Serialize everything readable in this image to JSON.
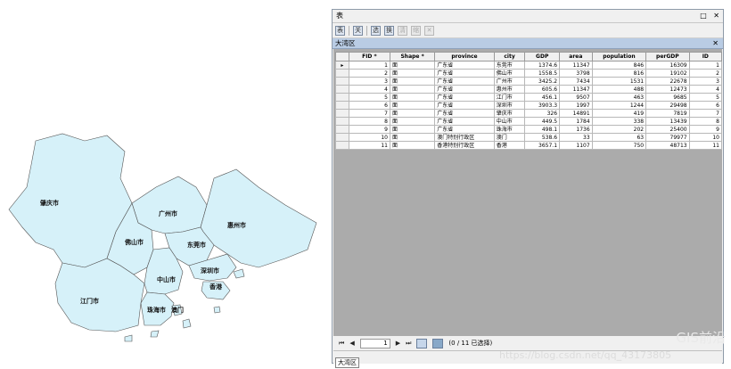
{
  "map": {
    "labels": {
      "zhaoqing": "肇庆市",
      "guangzhou": "广州市",
      "huizhou": "惠州市",
      "foshan": "佛山市",
      "dongguan": "东莞市",
      "zhongshan": "中山市",
      "shenzhen": "深圳市",
      "hongkong": "香港",
      "jiangmen": "江门市",
      "zhuhai": "珠海市",
      "macau": "澳门"
    },
    "fill_color": "#d6f1f9",
    "stroke_color": "#555555"
  },
  "window": {
    "title": "表",
    "pin": "□",
    "close": "✕",
    "toolbar": {
      "table_options": "表",
      "relate": "关",
      "select_by_attributes": "选",
      "switch_selection": "换",
      "clear_selection": "清",
      "zoom_selected": "缩",
      "delete_selected": "✕"
    },
    "tab": {
      "label": "大湾区",
      "close": "✕"
    },
    "table": {
      "columns": [
        "FID *",
        "Shape *",
        "province",
        "city",
        "GDP",
        "area",
        "population",
        "perGDP",
        "ID"
      ],
      "rows": [
        [
          "1",
          "面",
          "广东省",
          "东莞市",
          "1374.6",
          "11347",
          "846",
          "16309",
          "1"
        ],
        [
          "2",
          "面",
          "广东省",
          "佛山市",
          "1558.5",
          "3798",
          "816",
          "19102",
          "2"
        ],
        [
          "3",
          "面",
          "广东省",
          "广州市",
          "3425.2",
          "7434",
          "1531",
          "22678",
          "3"
        ],
        [
          "4",
          "面",
          "广东省",
          "惠州市",
          "605.6",
          "11347",
          "488",
          "12473",
          "4"
        ],
        [
          "5",
          "面",
          "广东省",
          "江门市",
          "456.1",
          "9507",
          "463",
          "9685",
          "5"
        ],
        [
          "6",
          "面",
          "广东省",
          "深圳市",
          "3903.3",
          "1997",
          "1244",
          "29498",
          "6"
        ],
        [
          "7",
          "面",
          "广东省",
          "肇庆市",
          "326",
          "14891",
          "419",
          "7819",
          "7"
        ],
        [
          "8",
          "面",
          "广东省",
          "中山市",
          "449.5",
          "1784",
          "338",
          "13439",
          "8"
        ],
        [
          "9",
          "面",
          "广东省",
          "珠海市",
          "498.1",
          "1736",
          "202",
          "25400",
          "9"
        ],
        [
          "10",
          "面",
          "澳门特别行政区",
          "澳门",
          "538.6",
          "33",
          "63",
          "79977",
          "10"
        ],
        [
          "11",
          "面",
          "香港特别行政区",
          "香港",
          "3657.1",
          "1107",
          "750",
          "48713",
          "11"
        ]
      ],
      "current_row_marker": "▸"
    },
    "nav": {
      "first": "⏮",
      "prev": "◀",
      "record": "1",
      "next": "▶",
      "last": "⏭",
      "selection_status": "(0 / 11 已选择)"
    },
    "bottom_tab": "大湾区"
  },
  "watermark": {
    "brand": "GIS前沿",
    "url": "https://blog.csdn.net/qq_43173805"
  }
}
